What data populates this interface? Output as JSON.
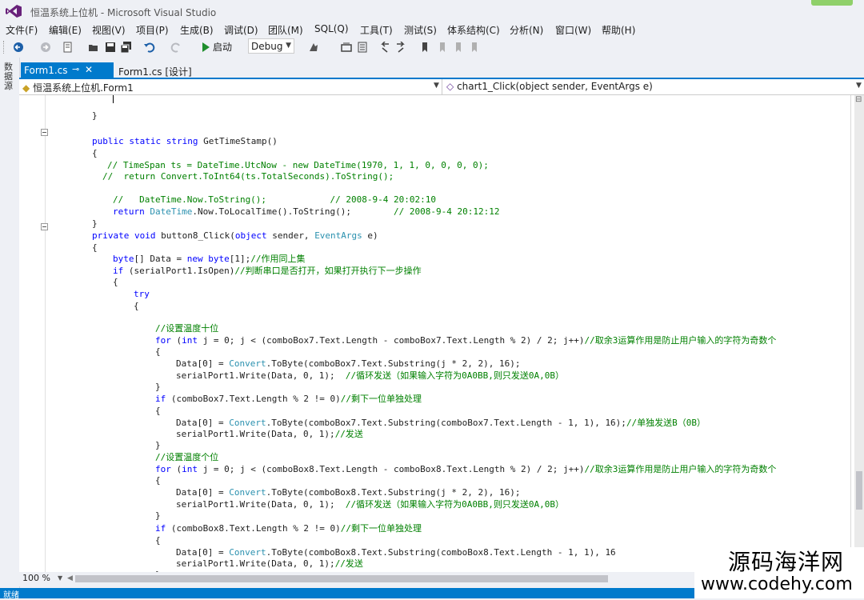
{
  "window": {
    "title": "恒温系统上位机 - Microsoft Visual Studio"
  },
  "menu": [
    "文件(F)",
    "编辑(E)",
    "视图(V)",
    "项目(P)",
    "生成(B)",
    "调试(D)",
    "团队(M)",
    "SQL(Q)",
    "工具(T)",
    "测试(S)",
    "体系结构(C)",
    "分析(N)",
    "窗口(W)",
    "帮助(H)"
  ],
  "toolbar": {
    "start_label": "启动",
    "configuration": "Debug"
  },
  "side_strip": {
    "label": "数据源"
  },
  "tabs": [
    {
      "label": "Form1.cs",
      "active": true
    },
    {
      "label": "Form1.cs [设计]",
      "active": false
    }
  ],
  "navbar": {
    "class_selector": "恒温系统上位机.Form1",
    "member_selector": "chart1_Click(object sender, EventArgs e)"
  },
  "code_lines": [
    {
      "text": "}"
    },
    {
      "text": "public static string GetTimeStamp()"
    },
    {
      "text": "{"
    },
    {
      "text": "// TimeSpan ts = DateTime.UtcNow - new DateTime(1970, 1, 1, 0, 0, 0, 0);"
    },
    {
      "text": "//  return Convert.ToInt64(ts.TotalSeconds).ToString();"
    },
    {
      "text": "//   DateTime.Now.ToString();            // 2008-9-4 20:02:10"
    },
    {
      "text": "return DateTime.Now.ToLocalTime().ToString();        // 2008-9-4 20:12:12"
    },
    {
      "text": "}"
    },
    {
      "text": "private void button8_Click(object sender, EventArgs e)"
    },
    {
      "text": "{"
    },
    {
      "text": "byte[] Data = new byte[1];//作用同上集"
    },
    {
      "text": "if (serialPort1.IsOpen)//判断串口是否打开，如果打开执行下一步操作"
    },
    {
      "text": "{"
    },
    {
      "text": "try"
    },
    {
      "text": "{"
    },
    {
      "text": "//设置温度十位"
    },
    {
      "text": "for (int j = 0; j < (comboBox7.Text.Length - comboBox7.Text.Length % 2) / 2; j++)//取余3运算作用是防止用户输入的字符为奇数个"
    },
    {
      "text": "{"
    },
    {
      "text": "Data[0] = Convert.ToByte(comboBox7.Text.Substring(j * 2, 2), 16);"
    },
    {
      "text": "serialPort1.Write(Data, 0, 1);  //循环发送（如果输入字符为0A0BB,则只发送0A,0B）"
    },
    {
      "text": "}"
    },
    {
      "text": "if (comboBox7.Text.Length % 2 != 0)//剩下一位单独处理"
    },
    {
      "text": "{"
    },
    {
      "text": "Data[0] = Convert.ToByte(comboBox7.Text.Substring(comboBox7.Text.Length - 1, 1), 16);//单独发送B（0B）"
    },
    {
      "text": "serialPort1.Write(Data, 0, 1);//发送"
    },
    {
      "text": "}"
    },
    {
      "text": "//设置温度个位"
    },
    {
      "text": "for (int j = 0; j < (comboBox8.Text.Length - comboBox8.Text.Length % 2) / 2; j++)//取余3运算作用是防止用户输入的字符为奇数个"
    },
    {
      "text": "{"
    },
    {
      "text": "Data[0] = Convert.ToByte(comboBox8.Text.Substring(j * 2, 2), 16);"
    },
    {
      "text": "serialPort1.Write(Data, 0, 1);  //循环发送（如果输入字符为0A0BB,则只发送0A,0B）"
    },
    {
      "text": "}"
    },
    {
      "text": "if (comboBox8.Text.Length % 2 != 0)//剩下一位单独处理"
    },
    {
      "text": "{"
    },
    {
      "text": "Data[0] = Convert.ToByte(comboBox8.Text.Substring(comboBox8.Text.Length - 1, 1), 16"
    },
    {
      "text": "serialPort1.Write(Data, 0, 1);//发送"
    },
    {
      "text": "}"
    }
  ],
  "zoom": "100 %",
  "status": "就绪",
  "watermark": {
    "name": "源码海洋网",
    "url": "www.codehy.com"
  },
  "colors": {
    "accent": "#007acc",
    "keyword": "#0000ff",
    "type": "#2b91af",
    "comment": "#008000"
  }
}
